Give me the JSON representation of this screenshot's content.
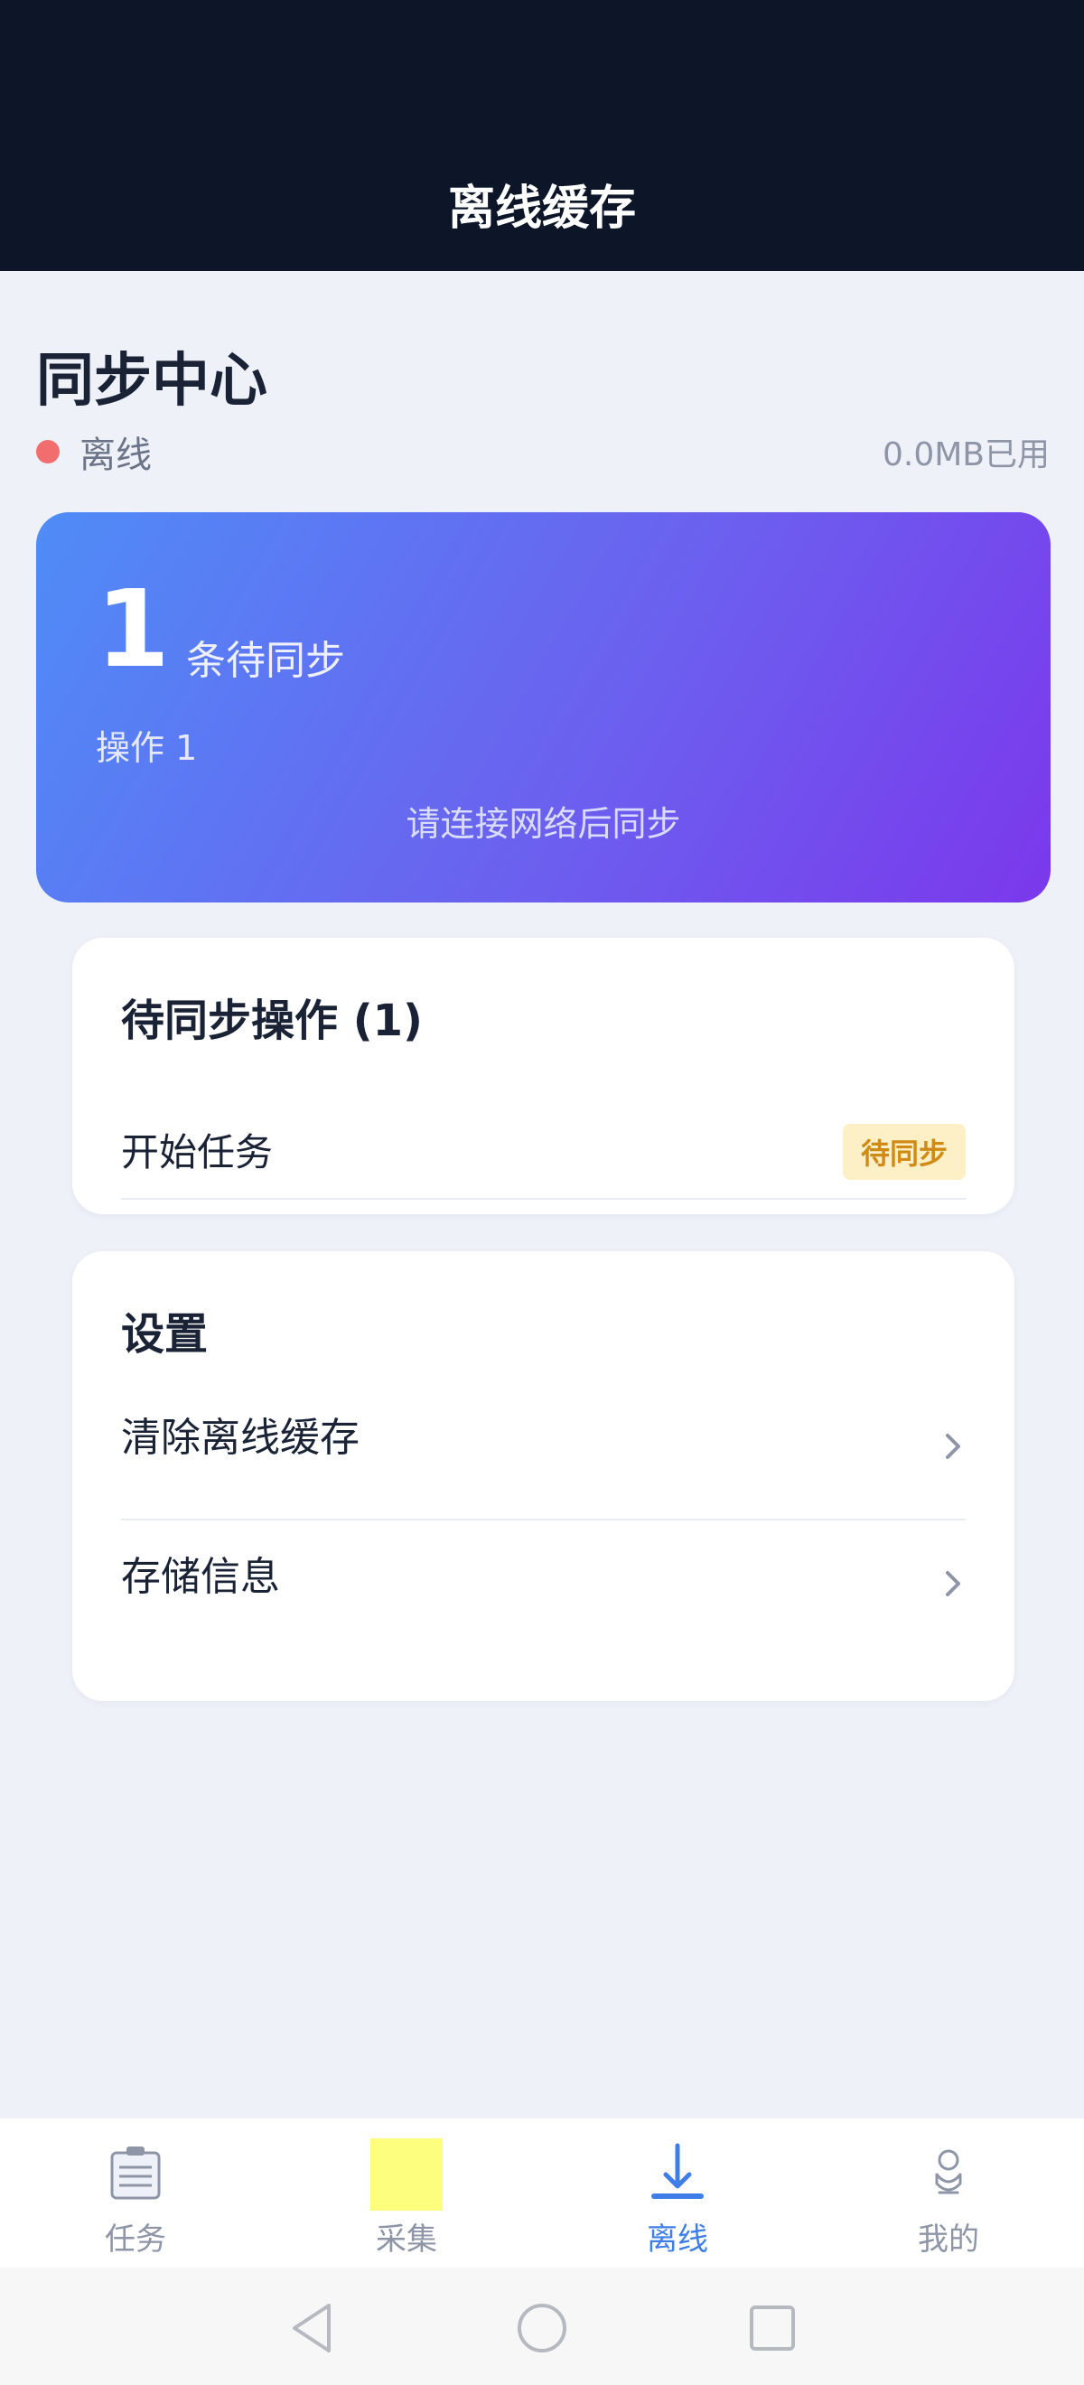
{
  "header": {
    "title": "离线缓存"
  },
  "page": {
    "title": "同步中心",
    "status": "离线",
    "storage_used": "0.0MB已用"
  },
  "sync_card": {
    "count": "1",
    "count_label": "条待同步",
    "sub": "操作 1",
    "hint": "请连接网络后同步"
  },
  "pending": {
    "title": "待同步操作 (1)",
    "items": [
      {
        "label": "开始任务",
        "badge": "待同步"
      }
    ]
  },
  "settings": {
    "title": "设置",
    "items": [
      {
        "label": "清除离线缓存"
      },
      {
        "label": "存储信息"
      }
    ]
  },
  "bottom_nav": {
    "items": [
      {
        "label": "任务",
        "icon": "clipboard-icon"
      },
      {
        "label": "采集",
        "icon": "collect-icon"
      },
      {
        "label": "离线",
        "icon": "download-icon",
        "active": true
      },
      {
        "label": "我的",
        "icon": "profile-icon"
      }
    ]
  },
  "colors": {
    "header_bg": "#0c1628",
    "accent": "#3f7ee8",
    "offline_dot": "#f26d6d",
    "badge_bg": "#fdf0c7",
    "badge_text": "#d08a16",
    "gradient_start": "#4f8cf7",
    "gradient_end": "#7b38ec"
  }
}
